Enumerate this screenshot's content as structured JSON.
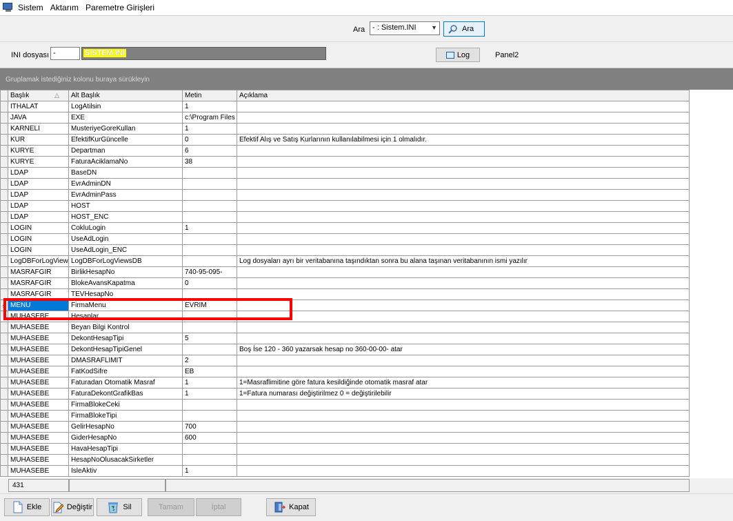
{
  "menu": [
    "Sistem",
    "Aktarım",
    "Paremetre Girişleri"
  ],
  "search": {
    "label": "Ara",
    "selected": "- : Sistem.INI",
    "button": "Ara"
  },
  "ini": {
    "label": "INI dosyası",
    "input_value": "-",
    "file_name": "SISTEM.INI",
    "log_button": "Log",
    "panel_label": "Panel2"
  },
  "group_hint": "Gruplamak istediğiniz kolonu buraya sürükleyin",
  "columns": [
    "Başlık",
    "Alt Başlık",
    "Metin",
    "Açıklama"
  ],
  "rows": [
    [
      "ITHALAT",
      "LogAtilsin",
      "1",
      ""
    ],
    [
      "JAVA",
      "EXE",
      "c:\\Program Files",
      ""
    ],
    [
      "KARNELI",
      "MusteriyeGoreKullan",
      "1",
      ""
    ],
    [
      "KUR",
      "EfektifKurGüncelle",
      "0",
      "Efektif Alış ve Satış Kurlarının kullanılabilmesi için 1 olmalıdır."
    ],
    [
      "KURYE",
      "Departman",
      "6",
      ""
    ],
    [
      "KURYE",
      "FaturaAciklamaNo",
      "38",
      ""
    ],
    [
      "LDAP",
      "BaseDN",
      "",
      ""
    ],
    [
      "LDAP",
      "EvrAdminDN",
      "",
      ""
    ],
    [
      "LDAP",
      "EvrAdminPass",
      "",
      ""
    ],
    [
      "LDAP",
      "HOST",
      "",
      ""
    ],
    [
      "LDAP",
      "HOST_ENC",
      "",
      ""
    ],
    [
      "LOGIN",
      "CokluLogin",
      "1",
      ""
    ],
    [
      "LOGIN",
      "UseAdLogin",
      "",
      ""
    ],
    [
      "LOGIN",
      "UseAdLogin_ENC",
      "",
      ""
    ],
    [
      "LogDBForLogView",
      "LogDBForLogViewsDB",
      "",
      "Log dosyaları ayrı bir veritabanına taşındıktan sonra bu alana taşınan veritabanının ismi yazılır"
    ],
    [
      "MASRAFGIR",
      "BirlikHesapNo",
      "740-95-095-",
      ""
    ],
    [
      "MASRAFGIR",
      "BlokeAvansKapatma",
      "0",
      ""
    ],
    [
      "MASRAFGIR",
      "TEVHesapNo",
      "",
      ""
    ],
    [
      "MENU",
      "FirmaMenu",
      "EVRIM",
      ""
    ],
    [
      "MUHASEBE",
      "Hesaplar",
      "",
      ""
    ],
    [
      "MUHASEBE",
      "Beyan Bilgi Kontrol",
      "",
      ""
    ],
    [
      "MUHASEBE",
      "DekontHesapTipi",
      "5",
      ""
    ],
    [
      "MUHASEBE",
      "DekontHesapTipiGenel",
      "",
      "Boş İse 120 - 360 yazarsak hesap no 360-00-00- atar"
    ],
    [
      "MUHASEBE",
      "DMASRAFLIMIT",
      "2",
      ""
    ],
    [
      "MUHASEBE",
      "FatKodSifre",
      "EB",
      ""
    ],
    [
      "MUHASEBE",
      "Faturadan Otomatik Masraf",
      "1",
      "1=Masraflimitine göre fatura kesildiğinde otomatik masraf atar"
    ],
    [
      "MUHASEBE",
      "FaturaDekontGrafikBas",
      "1",
      "1=Fatura numarası değiştirilmez 0 = değiştirilebilir"
    ],
    [
      "MUHASEBE",
      "FirmaBlokeCeki",
      "",
      ""
    ],
    [
      "MUHASEBE",
      "FirmaBlokeTipi",
      "",
      ""
    ],
    [
      "MUHASEBE",
      "GelirHesapNo",
      "700",
      ""
    ],
    [
      "MUHASEBE",
      "GiderHesapNo",
      "600",
      ""
    ],
    [
      "MUHASEBE",
      "HavaHesapTipi",
      "",
      ""
    ],
    [
      "MUHASEBE",
      "HesapNoOlusacakSirketler",
      "",
      ""
    ],
    [
      "MUHASEBE",
      "IsleAktiv",
      "1",
      ""
    ]
  ],
  "selected_row": 18,
  "record_count": "431",
  "toolbar": {
    "add": "Ekle",
    "edit": "Değiştir",
    "delete": "Sil",
    "ok": "Tamam",
    "cancel": "İptal",
    "close": "Kapat"
  },
  "colors": {
    "selection": "#0078d7",
    "highlight": "#ff0000",
    "ini_name_bg": "#ffff00"
  }
}
